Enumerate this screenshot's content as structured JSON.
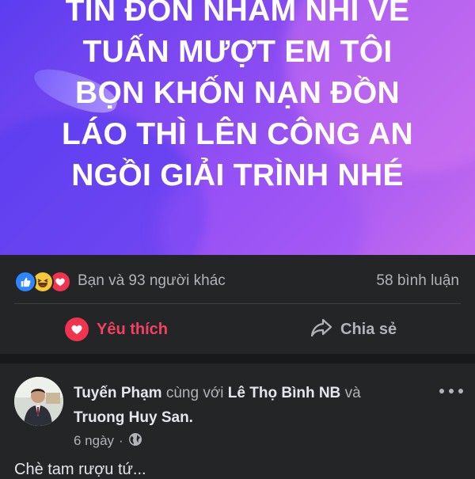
{
  "status_banner": {
    "lines": [
      "TIN ĐỒN NHẢM NHÍ VỀ",
      "TUẤN MƯỢT EM TÔI",
      "BỌN KHỐN NẠN ĐỒN",
      "LÁO THÌ LÊN CÔNG AN",
      "NGỒI GIẢI TRÌNH NHÉ"
    ],
    "gradient_colors": [
      "#5b3df0",
      "#8a4cf2",
      "#c66bf0"
    ]
  },
  "reactions": {
    "icons": [
      "like-icon",
      "haha-icon",
      "love-icon"
    ],
    "summary": "Bạn và 93 người khác",
    "comments": "58 bình luận"
  },
  "actions": {
    "like_label": "Yêu thích",
    "share_label": "Chia sẻ",
    "like_color": "#f3425f"
  },
  "next_post": {
    "author": "Tuyến Phạm",
    "with_text": "cùng với",
    "tagged_1": "Lê Thọ Bình NB",
    "and_text": "và",
    "tagged_2": "Truong Huy San.",
    "time": "6 ngày",
    "dot": "·",
    "privacy_icon": "globe-icon",
    "body": "Chè tam rượu tứ..."
  },
  "colors": {
    "background": "#242526",
    "separator": "#18191a",
    "text_primary": "#e4e6eb",
    "text_secondary": "#b0b3b8"
  }
}
